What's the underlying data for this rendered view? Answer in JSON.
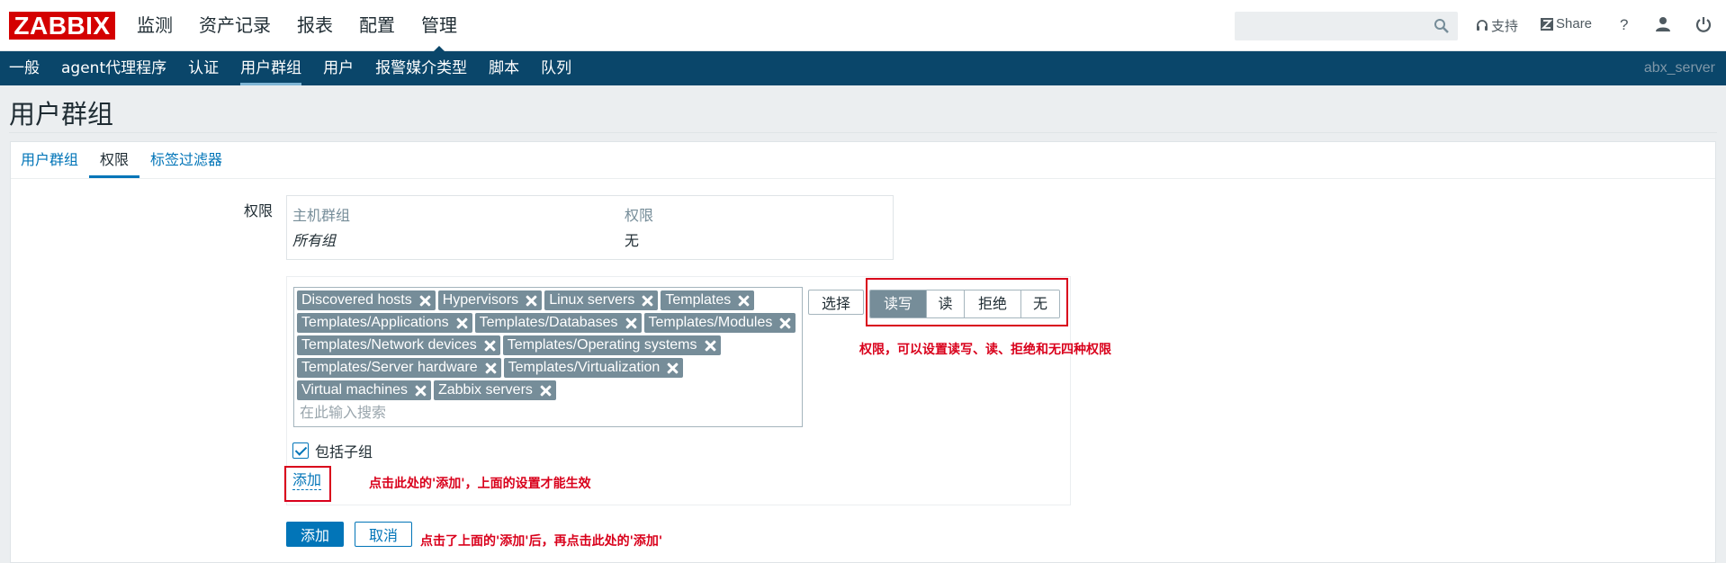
{
  "header": {
    "logo": "ZABBIX",
    "menu": [
      "监测",
      "资产记录",
      "报表",
      "配置",
      "管理"
    ],
    "active_menu": "管理",
    "search": {
      "value": "",
      "placeholder": ""
    },
    "support_label": "支持",
    "share_label": "Share",
    "help_label": "?"
  },
  "subnav": {
    "items": [
      "一般",
      "agent代理程序",
      "认证",
      "用户群组",
      "用户",
      "报警媒介类型",
      "脚本",
      "队列"
    ],
    "active": "用户群组",
    "server_name": "abx_server"
  },
  "page": {
    "title": "用户群组"
  },
  "tabs": [
    "用户群组",
    "权限",
    "标签过滤器"
  ],
  "active_tab": "权限",
  "permissions": {
    "label": "权限",
    "table": {
      "headers": [
        "主机群组",
        "权限"
      ],
      "rows": [
        [
          "所有组",
          "无"
        ]
      ]
    }
  },
  "group_selector": {
    "chips": [
      "Discovered hosts",
      "Hypervisors",
      "Linux servers",
      "Templates",
      "Templates/Applications",
      "Templates/Databases",
      "Templates/Modules",
      "Templates/Network devices",
      "Templates/Operating systems",
      "Templates/Server hardware",
      "Templates/Virtualization",
      "Virtual machines",
      "Zabbix servers"
    ],
    "search_placeholder": "在此输入搜索",
    "select_button": "选择",
    "permission_options": [
      "读写",
      "读",
      "拒绝",
      "无"
    ],
    "selected_permission": "读写",
    "include_subgroups_label": "包括子组",
    "include_subgroups_checked": true,
    "add_link": "添加"
  },
  "form_buttons": {
    "add": "添加",
    "cancel": "取消"
  },
  "annotations": {
    "permission_note": "权限，可以设置读写、读、拒绝和无四种权限",
    "add_link_note": "点击此处的'添加'，上面的设置才能生效",
    "add_button_note": "点击了上面的'添加'后，再点击此处的'添加'"
  },
  "colors": {
    "brand_red": "#d40000",
    "subnav_bg": "#0a466a",
    "link_blue": "#0275b8",
    "chip_grey": "#768d99",
    "annotation_red": "#d9001b"
  }
}
